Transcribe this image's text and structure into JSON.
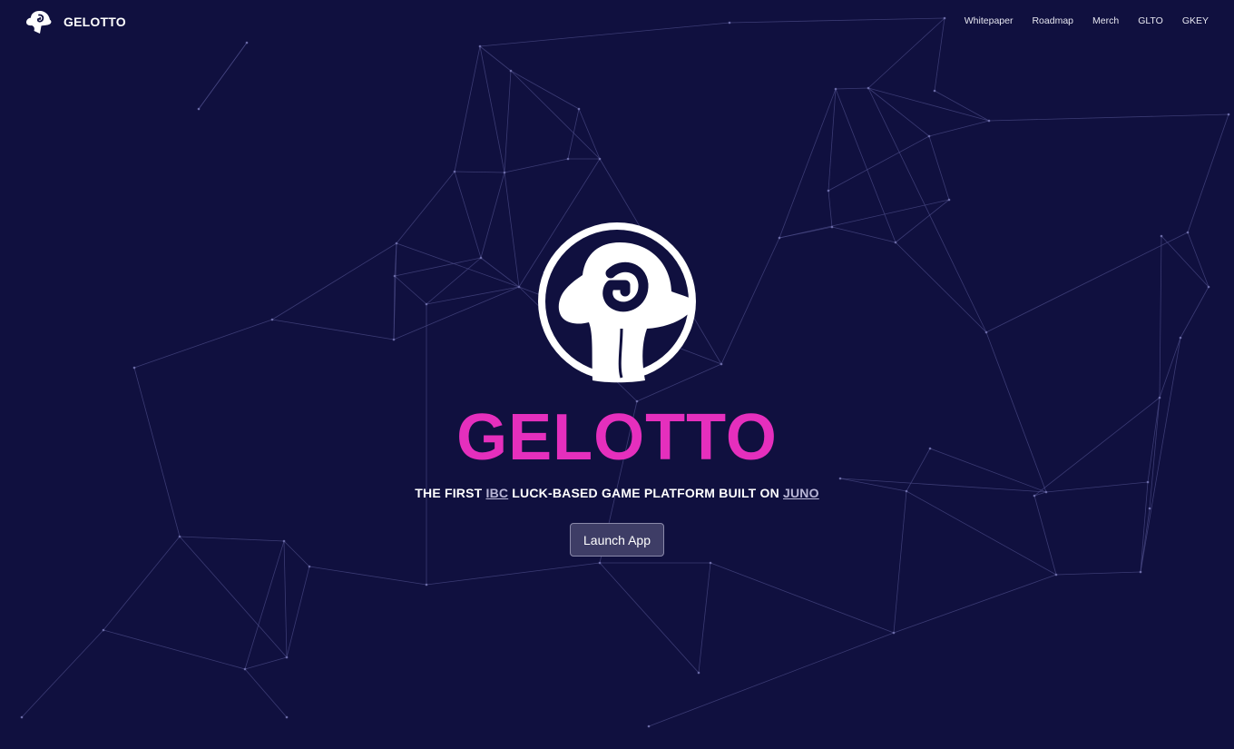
{
  "brand": {
    "name": "GELOTTO",
    "logo_icon": "gelotto-mushroom-icon"
  },
  "nav": {
    "items": [
      {
        "label": "Whitepaper"
      },
      {
        "label": "Roadmap"
      },
      {
        "label": "Merch"
      },
      {
        "label": "GLTO"
      },
      {
        "label": "GKEY"
      }
    ]
  },
  "hero": {
    "logo_icon": "gelotto-mushroom-icon",
    "title": "GELOTTO",
    "tagline_prefix": "THE FIRST ",
    "tagline_link1": "IBC",
    "tagline_middle": " LUCK-BASED GAME PLATFORM BUILT ON ",
    "tagline_link2": "JUNO",
    "button_label": "Launch App"
  },
  "colors": {
    "background": "#10103f",
    "title_accent": "#e52fbd",
    "link_muted": "#b9b6d6",
    "button_fill": "#3e3d66"
  }
}
